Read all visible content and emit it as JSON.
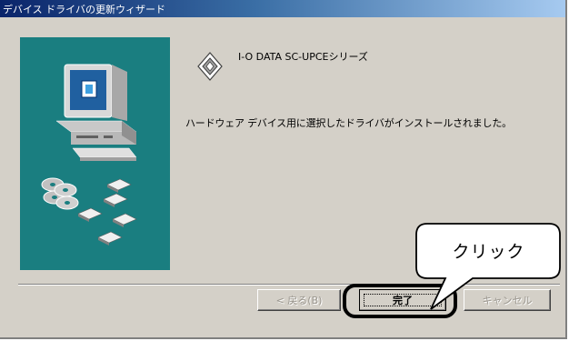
{
  "window": {
    "title": "デバイス ドライバの更新ウィザード"
  },
  "wizard": {
    "product_name": "I-O DATA SC-UPCEシリーズ",
    "message": "ハードウェア デバイス用に選択したドライバがインストールされました。",
    "icons": [
      "wizard-diamond-icon",
      "computer-icon",
      "cd-disc-icon",
      "floppy-disk-icon"
    ]
  },
  "buttons": {
    "back": "< 戻る(B)",
    "finish": "完了",
    "cancel": "キャンセル"
  },
  "annotation": {
    "callout": "クリック"
  },
  "colors": {
    "side_panel": "#1a7e80",
    "titlebar_start": "#0a246a",
    "titlebar_end": "#a6caf0",
    "dialog_face": "#d4d0c8"
  }
}
